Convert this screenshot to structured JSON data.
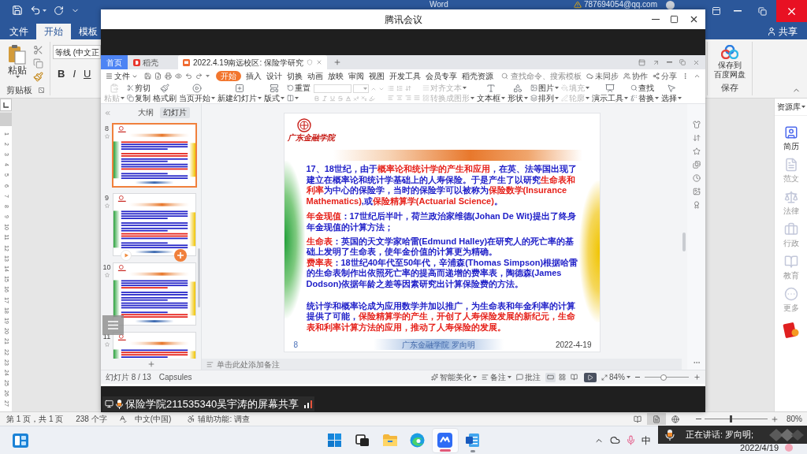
{
  "word": {
    "title_bar": {
      "app_name": "Word",
      "account": "787694054@qq.com"
    },
    "tabs": [
      {
        "label": "文件",
        "selected": false
      },
      {
        "label": "开始",
        "selected": true
      },
      {
        "label": "模板",
        "selected": false
      }
    ],
    "share": "共享",
    "ribbon": {
      "paste": "粘贴",
      "clipboard_group": "剪贴板",
      "font_name": "等线 (中文正",
      "format_buttons": [
        "B",
        "I",
        "U"
      ],
      "cloud_save": [
        "保存到",
        "百度网盘"
      ],
      "save_group": "保存"
    },
    "ruler_numbers": [
      "1",
      "2",
      "3",
      "4",
      "5",
      "6",
      "7",
      "8",
      "9",
      "10",
      "11",
      "12",
      "13",
      "14",
      "15",
      "16",
      "17",
      "18",
      "19",
      "20",
      "21",
      "22",
      "23",
      "24",
      "25",
      "26",
      "27"
    ],
    "resource_panel": {
      "title": "资源库",
      "items": [
        {
          "label": "简历",
          "selected": true
        },
        {
          "label": "范文",
          "selected": false
        },
        {
          "label": "法律",
          "selected": false
        },
        {
          "label": "行政",
          "selected": false
        },
        {
          "label": "教育",
          "selected": false
        },
        {
          "label": "更多",
          "selected": false
        }
      ]
    },
    "status_bar": {
      "page": "第 1 页，共 1 页",
      "words": "238 个字",
      "language": "中文(中国)",
      "accessibility": "辅助功能: 调查",
      "views": [
        {
          "selected": false
        },
        {
          "selected": true
        },
        {
          "selected": false
        }
      ],
      "zoom": "80%",
      "zoom_slider": {
        "level": 0.4
      }
    }
  },
  "meeting": {
    "title": "腾讯会议",
    "share_label": "保险学院211535340吴宇涛的屏幕共享"
  },
  "wps": {
    "tabs": [
      {
        "label": "首页",
        "kind": "home",
        "selected": false
      },
      {
        "label": "稻壳",
        "kind": "docer",
        "selected": false
      },
      {
        "label": "2022.4.19南远校区: 保险学研究",
        "kind": "document",
        "selected": true
      }
    ],
    "menu": {
      "file": "文件",
      "items": [
        {
          "label": "开始",
          "selected": true
        },
        {
          "label": "插入",
          "selected": false
        },
        {
          "label": "设计",
          "selected": false
        },
        {
          "label": "切换",
          "selected": false
        },
        {
          "label": "动画",
          "selected": false
        },
        {
          "label": "放映",
          "selected": false
        },
        {
          "label": "审阅",
          "selected": false
        },
        {
          "label": "视图",
          "selected": false
        },
        {
          "label": "开发工具",
          "selected": false
        },
        {
          "label": "会员专享",
          "selected": false
        },
        {
          "label": "稻壳资源",
          "selected": false
        }
      ],
      "search_placeholder": "查找命令、搜索模板",
      "actions": [
        "未同步",
        "协作",
        "分享"
      ]
    },
    "toolbar": [
      {
        "kind": "large",
        "label": "粘贴",
        "menu": true,
        "disabled": true
      },
      {
        "kind": "pair",
        "items": [
          {
            "label": "剪切",
            "menu": false,
            "disabled": false
          },
          {
            "label": "复制",
            "menu": false,
            "disabled": false
          }
        ]
      },
      {
        "kind": "large",
        "label": "格式刷",
        "menu": false,
        "disabled": false
      },
      {
        "kind": "large",
        "label": "当页开始",
        "menu": true,
        "disabled": false
      },
      {
        "kind": "large",
        "label": "新建幻灯片",
        "menu": true,
        "disabled": false
      },
      {
        "kind": "large",
        "label": "版式",
        "menu": true,
        "disabled": false
      },
      {
        "kind": "pair",
        "items": [
          {
            "label": "重置",
            "menu": false,
            "disabled": false
          },
          {
            "menu": true,
            "disabled": false
          }
        ]
      },
      {
        "kind": "font"
      },
      {
        "kind": "paragraph"
      },
      {
        "kind": "pair",
        "items": [
          {
            "label": "对齐文本",
            "menu": true,
            "disabled": true
          },
          {
            "label": "转换成图形",
            "menu": true,
            "disabled": true
          }
        ]
      },
      {
        "kind": "large",
        "label": "文本框",
        "menu": true,
        "disabled": false
      },
      {
        "kind": "large",
        "label": "形状",
        "menu": true,
        "disabled": false
      },
      {
        "kind": "pair",
        "items": [
          {
            "label": "图片",
            "menu": true,
            "disabled": false
          },
          {
            "label": "排列",
            "menu": true,
            "disabled": false
          }
        ]
      },
      {
        "kind": "pair",
        "items": [
          {
            "label": "填充",
            "menu": true,
            "disabled": true
          },
          {
            "label": "轮廓",
            "menu": true,
            "disabled": true
          }
        ]
      },
      {
        "kind": "large",
        "label": "演示工具",
        "menu": true,
        "disabled": false
      },
      {
        "kind": "pair",
        "items": [
          {
            "label": "查找",
            "menu": false,
            "disabled": false
          },
          {
            "label": "替换",
            "menu": true,
            "disabled": false
          }
        ]
      },
      {
        "kind": "large",
        "label": "选择",
        "menu": true,
        "disabled": false
      }
    ],
    "panel": {
      "tabs": [
        {
          "label": "大纲",
          "selected": false
        },
        {
          "label": "幻灯片",
          "selected": true
        }
      ],
      "slides": [
        {
          "number": "8",
          "selected": true,
          "hovered": false
        },
        {
          "number": "9",
          "selected": false,
          "hovered": true
        },
        {
          "number": "10",
          "selected": false,
          "hovered": false
        },
        {
          "number": "11",
          "selected": false,
          "hovered": false
        }
      ]
    },
    "slide": {
      "logo_text": "广东金融学院",
      "paragraphs": [
        {
          "runs": [
            {
              "text": "17、18世纪，由于",
              "highlight": false
            },
            {
              "text": "概率论和统计学的产生和应用",
              "highlight": true
            },
            {
              "text": "，在英、法等国出现了建立在概率论和统计学基础上的人寿保险。于是产生了以研究",
              "highlight": false
            },
            {
              "text": "生命表和利率",
              "highlight": true
            },
            {
              "text": "为中心的保险学，当时的保险学可以被称为",
              "highlight": false
            },
            {
              "text": "保险数学(Insurance Mathematics)",
              "highlight": true
            },
            {
              "text": ",或",
              "highlight": false
            },
            {
              "text": "保险精算学(Actuarial Science)",
              "highlight": true
            },
            {
              "text": "。",
              "highlight": false
            }
          ]
        },
        {
          "runs": [
            {
              "text": "年金现值",
              "highlight": true
            },
            {
              "text": "：17世纪后半叶，荷兰政治家维德(Johan De Wit)提出了终身年金现值的计算方法；",
              "highlight": false
            }
          ]
        },
        {
          "runs": [
            {
              "text": "生命表",
              "highlight": true
            },
            {
              "text": "：英国的天文学家哈雷(Edmund Halley)在研究人的死亡率的基础上发明了生命表，使年金价值的计算更为精确。",
              "highlight": false
            }
          ]
        },
        {
          "runs": [
            {
              "text": "费率表",
              "highlight": true
            },
            {
              "text": "：18世纪40年代至50年代，辛浦森(Thomas Simpson)根据哈雷的生命表制作出依照死亡率的提高而递增的费率表，陶德森(James Dodson)依据年龄之差等因素研究出计算保险费的方法。",
              "highlight": false
            }
          ]
        },
        {
          "runs": [
            {
              "text": "统计学和概率论成为应用数学并加以推广，为生命表和年金利率的计算提供了可能，",
              "highlight": false
            },
            {
              "text": "保险精算学的产生，开创了人寿保险发展的新纪元，生命表和利率计算方法的应用，推动了人寿保险的发展。",
              "highlight": true
            }
          ]
        }
      ],
      "page_number": "8",
      "footer": "广东金融学院 罗向明",
      "date": "2022-4-19"
    },
    "notes": {
      "placeholder": "单击此处添加备注"
    },
    "status_bar": {
      "slide_counter": "幻灯片 8 / 13",
      "theme": "Capsules",
      "beautify": "智能美化",
      "notes": "备注",
      "comments": "批注",
      "views": [
        {
          "selected": true
        },
        {
          "selected": false
        },
        {
          "selected": false
        }
      ],
      "zoom": "84%",
      "zoom_slider": {
        "level": 0.43
      }
    }
  },
  "taskbar": {
    "apps": [
      {
        "kind": "start",
        "running": false,
        "active": false
      },
      {
        "kind": "task_view",
        "running": false,
        "active": false
      },
      {
        "kind": "explorer",
        "running": false,
        "active": false
      },
      {
        "kind": "edge",
        "running": false,
        "active": false
      },
      {
        "kind": "meeting",
        "running": true,
        "active": true
      },
      {
        "kind": "word",
        "running": true,
        "active": false
      }
    ],
    "ime": "中",
    "date": "2022/4/19"
  },
  "speaker_popup": {
    "text": "正在讲话: 罗向明;"
  }
}
